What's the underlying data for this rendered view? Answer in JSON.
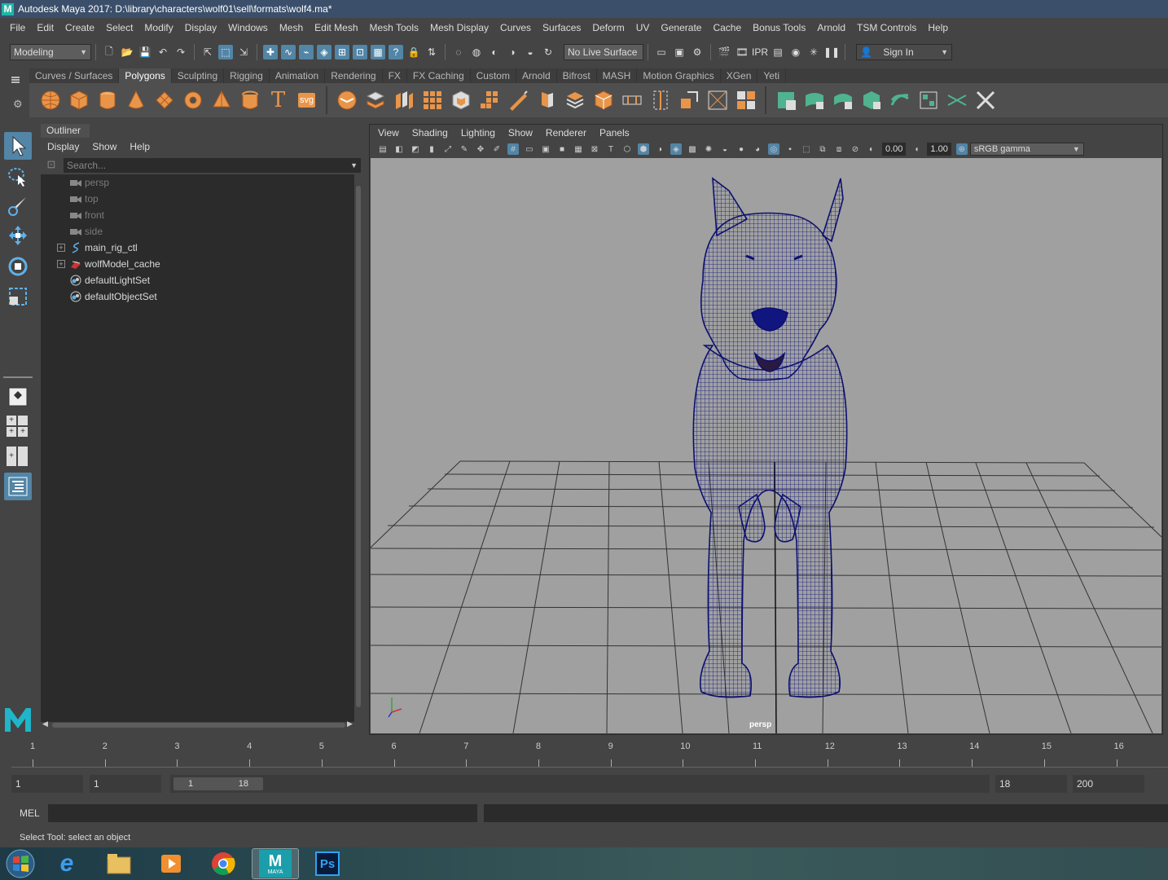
{
  "window": {
    "title": "Autodesk Maya 2017: D:\\library\\characters\\wolf01\\sell\\formats\\wolf4.ma*"
  },
  "menubar": {
    "items": [
      "File",
      "Edit",
      "Create",
      "Select",
      "Modify",
      "Display",
      "Windows",
      "Mesh",
      "Edit Mesh",
      "Mesh Tools",
      "Mesh Display",
      "Curves",
      "Surfaces",
      "Deform",
      "UV",
      "Generate",
      "Cache",
      "Bonus Tools",
      "Arnold",
      "TSM Controls",
      "Help"
    ]
  },
  "statusline": {
    "menuset": "Modeling",
    "live_surface": "No Live Surface",
    "sign_in": "Sign In"
  },
  "shelf": {
    "tabs": [
      "Curves / Surfaces",
      "Polygons",
      "Sculpting",
      "Rigging",
      "Animation",
      "Rendering",
      "FX",
      "FX Caching",
      "Custom",
      "Arnold",
      "Bifrost",
      "MASH",
      "Motion Graphics",
      "XGen",
      "Yeti"
    ],
    "active_tab": "Polygons",
    "svg_label": "svg",
    "text_label": "T"
  },
  "outliner": {
    "title": "Outliner",
    "menu": [
      "Display",
      "Show",
      "Help"
    ],
    "search_placeholder": "Search...",
    "items": [
      {
        "label": "persp",
        "icon": "camera-icon"
      },
      {
        "label": "top",
        "icon": "camera-icon"
      },
      {
        "label": "front",
        "icon": "camera-icon"
      },
      {
        "label": "side",
        "icon": "camera-icon"
      },
      {
        "label": "main_rig_ctl",
        "icon": "curve-icon"
      },
      {
        "label": "wolfModel_cache",
        "icon": "cache-icon"
      },
      {
        "label": "defaultLightSet",
        "icon": "set-icon"
      },
      {
        "label": "defaultObjectSet",
        "icon": "set-icon"
      }
    ]
  },
  "viewport": {
    "menu": [
      "View",
      "Shading",
      "Lighting",
      "Show",
      "Renderer",
      "Panels"
    ],
    "exposure": "0.00",
    "gamma": "1.00",
    "color_space": "sRGB gamma",
    "camera": "persp"
  },
  "timeline": {
    "ticks": [
      "1",
      "2",
      "3",
      "4",
      "5",
      "6",
      "7",
      "8",
      "9",
      "10",
      "11",
      "12",
      "13",
      "14",
      "15",
      "16"
    ],
    "range_start": "1",
    "playback_start": "1",
    "slider_start": "1",
    "slider_end": "18",
    "playback_end": "18",
    "range_end": "200"
  },
  "commandline": {
    "label": "MEL"
  },
  "helpline": {
    "text": "Select Tool: select an object"
  },
  "taskbar": {
    "apps": [
      "windows-start-icon",
      "internet-explorer-icon",
      "file-explorer-icon",
      "media-player-icon",
      "chrome-icon",
      "maya-icon",
      "photoshop-icon"
    ],
    "maya_label": "MAYA",
    "ps_label": "Ps"
  },
  "colors": {
    "accent": "#5285a6",
    "wireframe": "#101580",
    "viewport_bg": "#a0a0a0",
    "shelf_icon": "#e8954a"
  }
}
